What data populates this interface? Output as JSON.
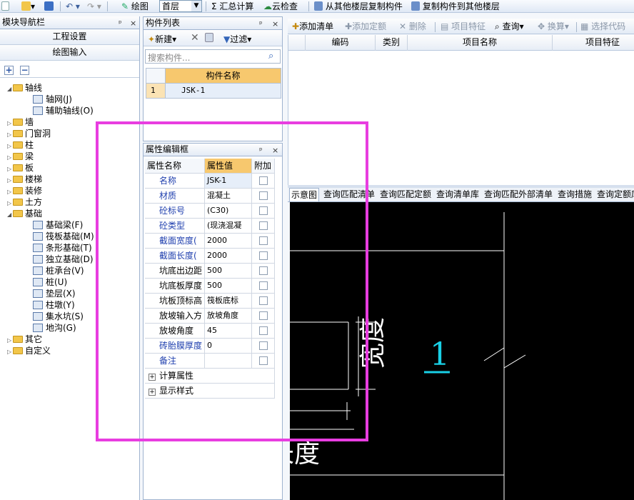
{
  "toolbar": {
    "draw_label": "绘图",
    "floor_value": "首层",
    "sum_calc": "汇总计算",
    "cloud_check": "云检查",
    "copy_from_floor": "从其他楼层复制构件",
    "copy_to_floor": "复制构件到其他楼层"
  },
  "nav_panel": {
    "title": "模块导航栏",
    "pin": "ᵖ ×",
    "btn_project_settings": "工程设置",
    "btn_draw_input": "绘图输入",
    "tree": [
      {
        "label": "轴线",
        "children": [
          {
            "label": "轴网(J)"
          },
          {
            "label": "辅助轴线(O)"
          }
        ]
      },
      {
        "label": "墙"
      },
      {
        "label": "门窗洞"
      },
      {
        "label": "柱"
      },
      {
        "label": "梁"
      },
      {
        "label": "板"
      },
      {
        "label": "楼梯"
      },
      {
        "label": "装修"
      },
      {
        "label": "土方"
      },
      {
        "label": "基础",
        "children": [
          {
            "label": "基础梁(F)"
          },
          {
            "label": "筏板基础(M)"
          },
          {
            "label": "条形基础(T)"
          },
          {
            "label": "独立基础(D)"
          },
          {
            "label": "桩承台(V)"
          },
          {
            "label": "桩(U)"
          },
          {
            "label": "垫层(X)"
          },
          {
            "label": "柱墩(Y)"
          },
          {
            "label": "集水坑(S)"
          },
          {
            "label": "地沟(G)"
          }
        ]
      },
      {
        "label": "其它"
      },
      {
        "label": "自定义"
      }
    ]
  },
  "component_list": {
    "title": "构件列表",
    "new_label": "新建",
    "filter_label": "过滤",
    "search_placeholder": "搜索构件...",
    "col_name": "构件名称",
    "rows": [
      {
        "idx": "1",
        "name": "JSK-1"
      }
    ]
  },
  "prop_editor": {
    "title": "属性编辑框",
    "col_name": "属性名称",
    "col_value": "属性值",
    "col_extra": "附加",
    "rows": [
      {
        "name": "名称",
        "value": "JSK-1",
        "blue": true
      },
      {
        "name": "材质",
        "value": "混凝土",
        "blue": true
      },
      {
        "name": "砼标号",
        "value": "(C30)",
        "blue": true
      },
      {
        "name": "砼类型",
        "value": "(现浇混凝",
        "blue": true
      },
      {
        "name": "截面宽度(",
        "value": "2000",
        "blue": true
      },
      {
        "name": "截面长度(",
        "value": "2000",
        "blue": true
      },
      {
        "name": "坑底出边距",
        "value": "500",
        "blue": false
      },
      {
        "name": "坑底板厚度",
        "value": "500",
        "blue": false
      },
      {
        "name": "坑板顶标高",
        "value": "筏板底标",
        "blue": false
      },
      {
        "name": "放坡输入方",
        "value": "放坡角度",
        "blue": false
      },
      {
        "name": "放坡角度",
        "value": "45",
        "blue": false
      },
      {
        "name": "砖胎膜厚度",
        "value": "0",
        "blue": true
      },
      {
        "name": "备注",
        "value": "",
        "blue": true
      }
    ],
    "group_calc": "计算属性",
    "group_display": "显示样式"
  },
  "list_toolbar": {
    "add_list": "添加清单",
    "add_quota": "添加定额",
    "delete": "删除",
    "item_feature": "项目特征",
    "query": "查询",
    "convert": "换算",
    "select_code": "选择代码"
  },
  "list_grid": {
    "col_code": "编码",
    "col_type": "类别",
    "col_name": "项目名称",
    "col_feature": "项目特征"
  },
  "bottom_tabs": [
    "示意图",
    "查询匹配清单",
    "查询匹配定额",
    "查询清单库",
    "查询匹配外部清单",
    "查询措施",
    "查询定额库"
  ],
  "diagram": {
    "label_width": "宽度",
    "label_length": "长度",
    "label_num": "1"
  },
  "colors": {
    "highlight": "#e83de0",
    "header_orange": "#f7c86e",
    "canvas": "#000000",
    "cyan": "#19d0e6"
  }
}
